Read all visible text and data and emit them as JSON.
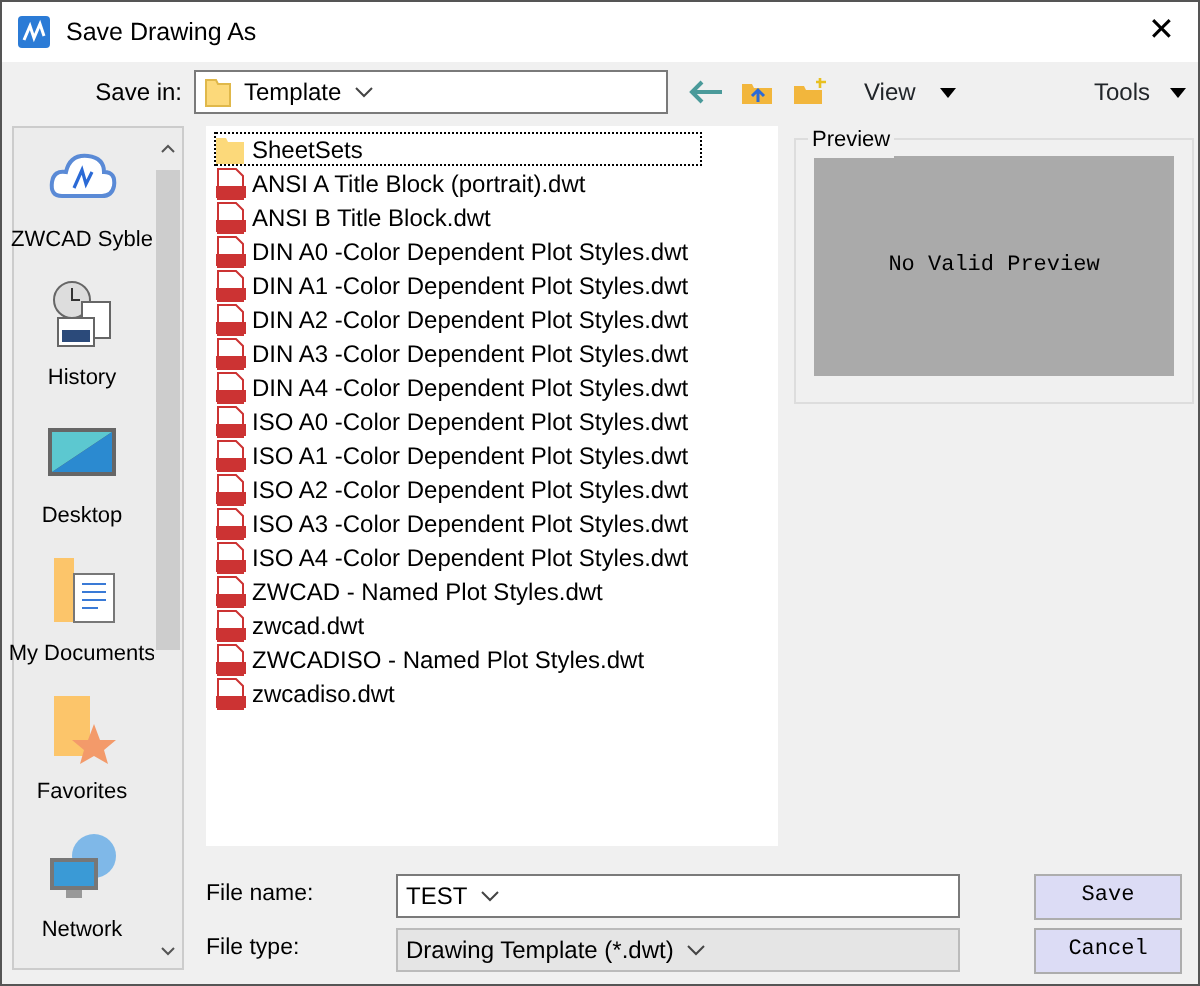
{
  "window": {
    "title": "Save Drawing As",
    "close": "✕"
  },
  "toolbar": {
    "save_in_label": "Save in:",
    "location": "Template",
    "view": "View",
    "tools": "Tools"
  },
  "places": [
    {
      "label": "ZWCAD Syble",
      "kind": "cloud"
    },
    {
      "label": "History",
      "kind": "history"
    },
    {
      "label": "Desktop",
      "kind": "desktop"
    },
    {
      "label": "My Documents",
      "kind": "documents"
    },
    {
      "label": "Favorites",
      "kind": "favorites"
    },
    {
      "label": "Network",
      "kind": "network"
    }
  ],
  "files": [
    {
      "name": "SheetSets",
      "kind": "folder",
      "selected": true
    },
    {
      "name": "ANSI A Title Block (portrait).dwt",
      "kind": "dwt",
      "selected": false
    },
    {
      "name": "ANSI B Title Block.dwt",
      "kind": "dwt",
      "selected": false
    },
    {
      "name": "DIN A0 -Color Dependent Plot Styles.dwt",
      "kind": "dwt",
      "selected": false
    },
    {
      "name": "DIN A1 -Color Dependent Plot Styles.dwt",
      "kind": "dwt",
      "selected": false
    },
    {
      "name": "DIN A2 -Color Dependent Plot Styles.dwt",
      "kind": "dwt",
      "selected": false
    },
    {
      "name": "DIN A3 -Color Dependent Plot Styles.dwt",
      "kind": "dwt",
      "selected": false
    },
    {
      "name": "DIN A4 -Color Dependent Plot Styles.dwt",
      "kind": "dwt",
      "selected": false
    },
    {
      "name": "ISO A0 -Color Dependent Plot Styles.dwt",
      "kind": "dwt",
      "selected": false
    },
    {
      "name": "ISO A1 -Color Dependent Plot Styles.dwt",
      "kind": "dwt",
      "selected": false
    },
    {
      "name": "ISO A2 -Color Dependent Plot Styles.dwt",
      "kind": "dwt",
      "selected": false
    },
    {
      "name": "ISO A3 -Color Dependent Plot Styles.dwt",
      "kind": "dwt",
      "selected": false
    },
    {
      "name": "ISO A4 -Color Dependent Plot Styles.dwt",
      "kind": "dwt",
      "selected": false
    },
    {
      "name": "ZWCAD - Named Plot Styles.dwt",
      "kind": "dwt",
      "selected": false
    },
    {
      "name": "zwcad.dwt",
      "kind": "dwt",
      "selected": false
    },
    {
      "name": "ZWCADISO - Named Plot Styles.dwt",
      "kind": "dwt",
      "selected": false
    },
    {
      "name": "zwcadiso.dwt",
      "kind": "dwt",
      "selected": false
    }
  ],
  "preview": {
    "title": "Preview",
    "message": "No Valid Preview"
  },
  "file_name": {
    "label": "File name:",
    "value": "TEST"
  },
  "file_type": {
    "label": "File type:",
    "value": "Drawing Template (*.dwt)"
  },
  "buttons": [
    "Save",
    "Cancel"
  ]
}
